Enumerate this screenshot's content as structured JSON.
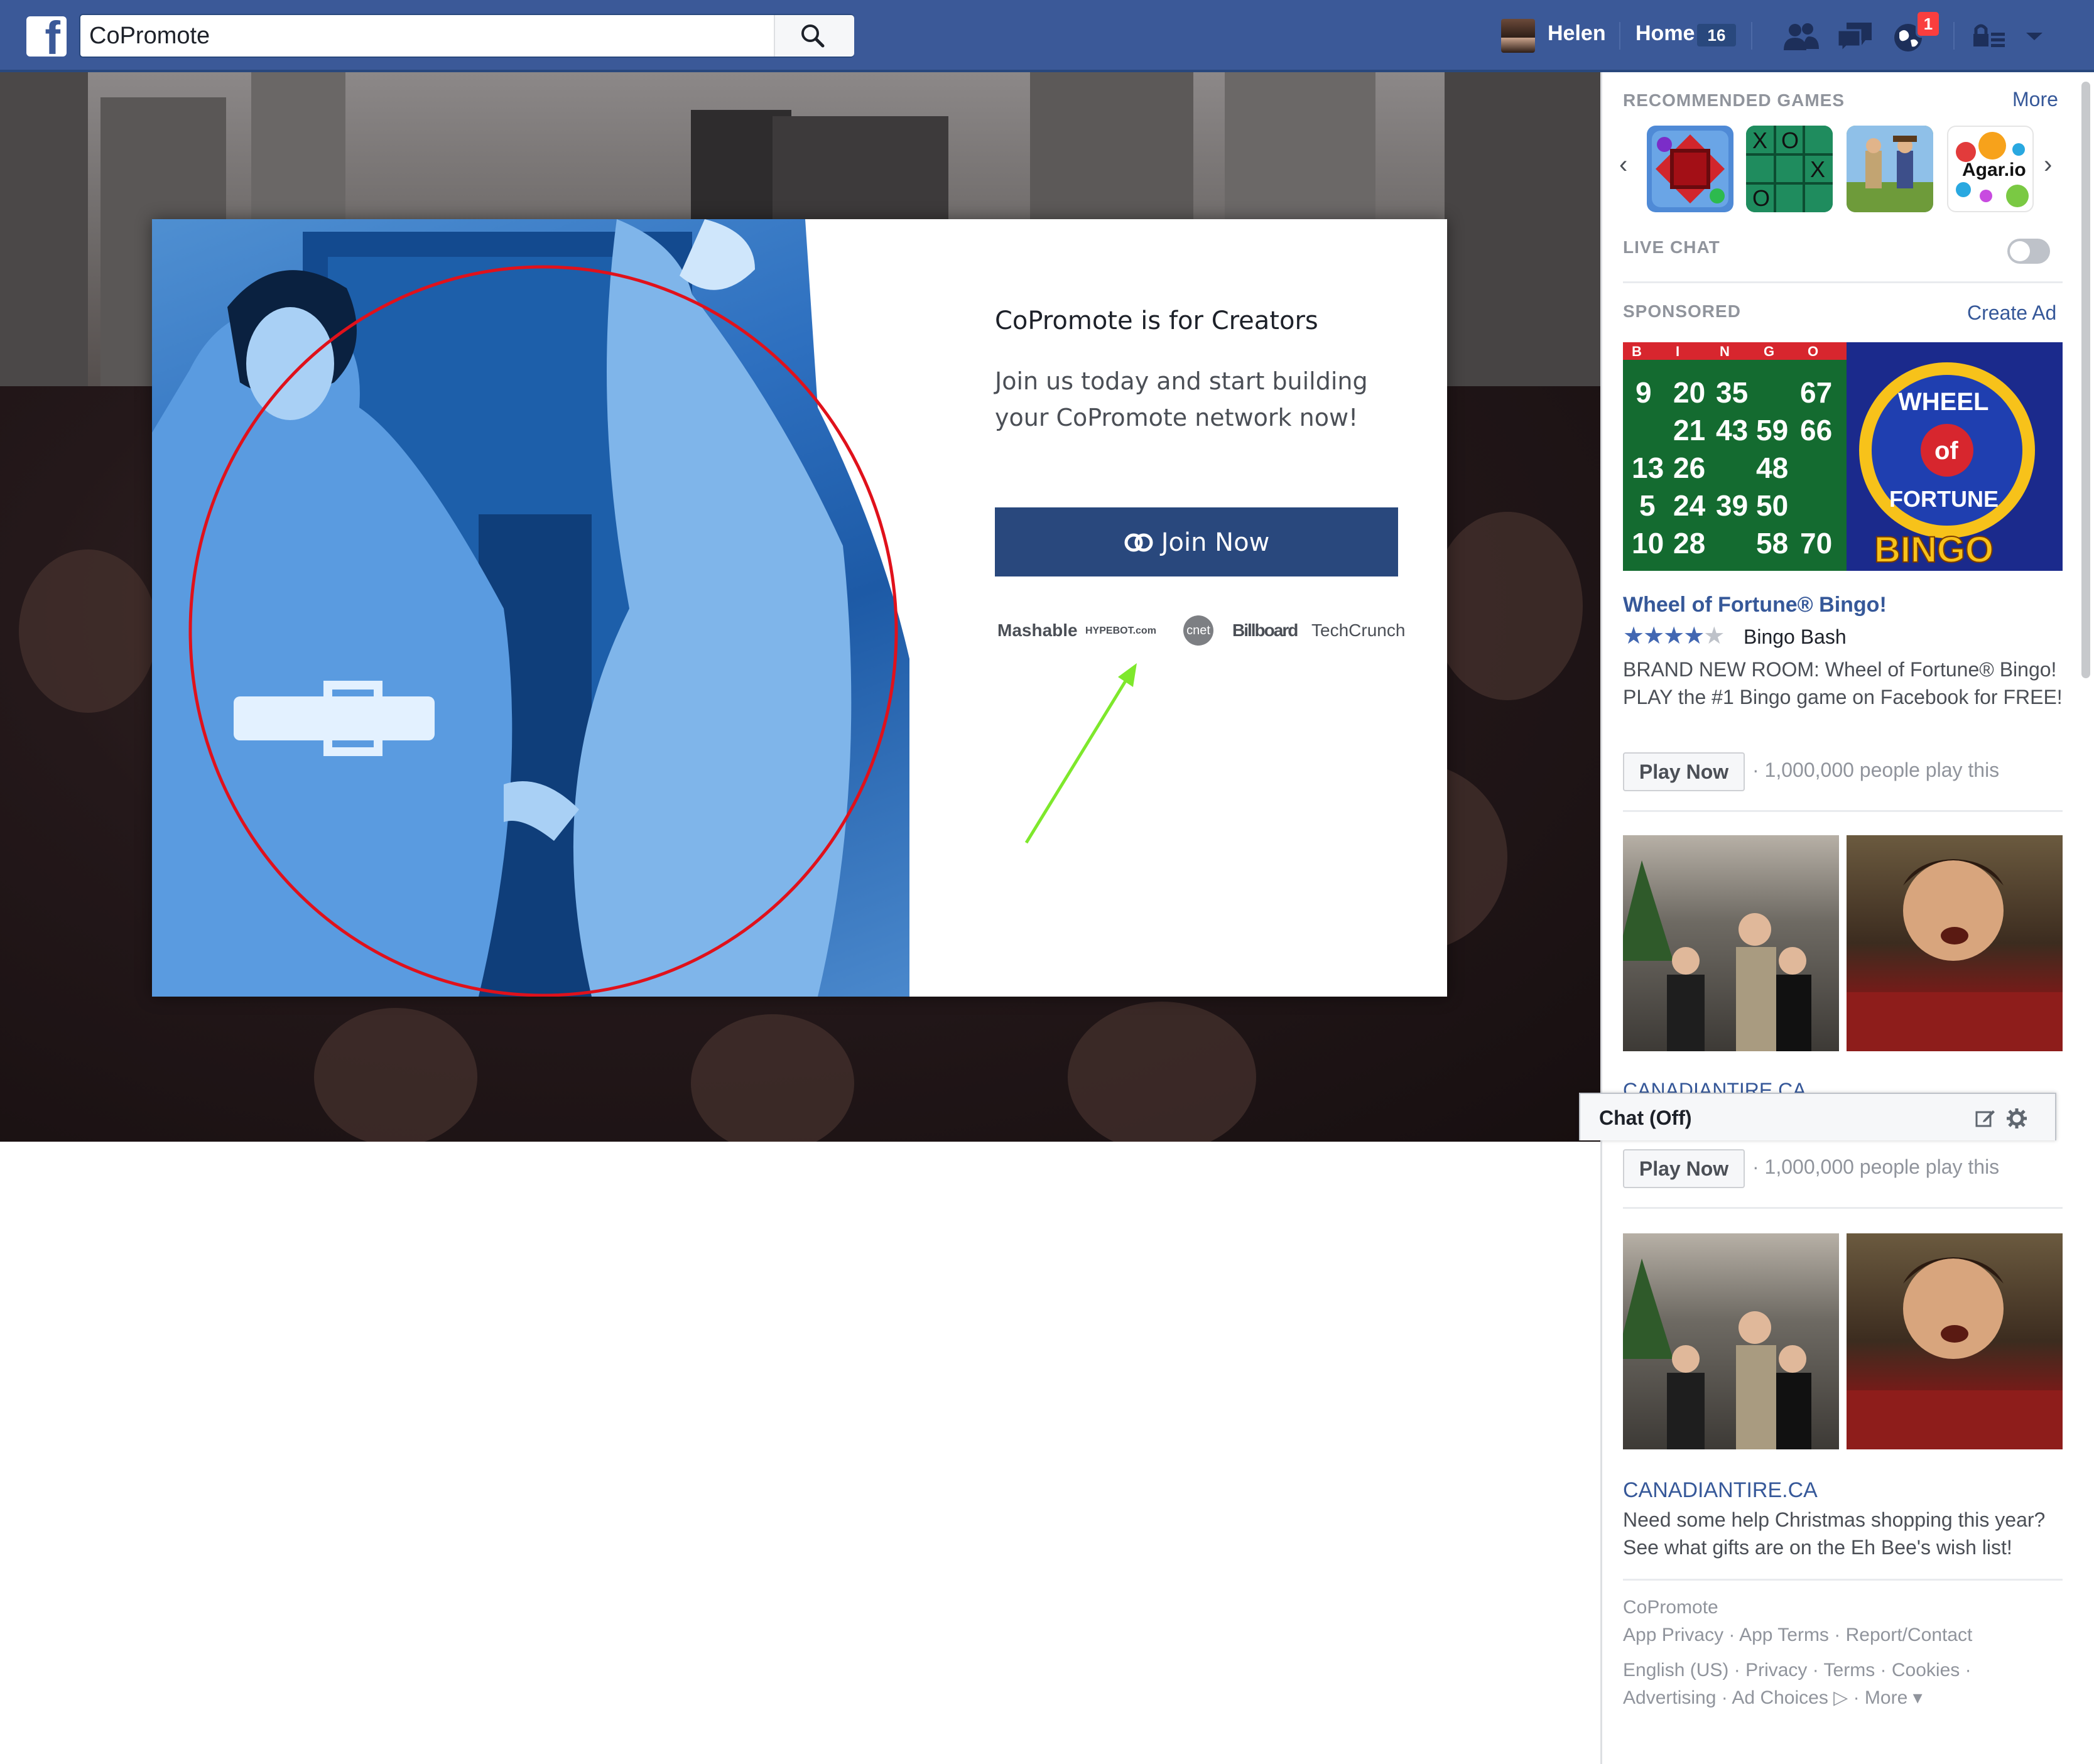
{
  "topbar": {
    "logo_letter": "f",
    "search_value": "CoPromote",
    "user_name": "Helen",
    "home_label": "Home",
    "home_count": "16",
    "notification_count": "1",
    "brand_color": "#3b5998"
  },
  "modal": {
    "heading": "CoPromote is for Creators",
    "body": "Join us today and start building your CoPromote network now!",
    "join_label": "Join Now",
    "press": {
      "mashable": "Mashable",
      "hypebot": "HYPEBOT.com",
      "cnet": "cnet",
      "billboard": "Billboard",
      "techcrunch": "TechCrunch"
    },
    "button_color": "#29487d",
    "annotation_circle_color": "#e0111b",
    "annotation_arrow_color": "#7ee82c"
  },
  "sidebar": {
    "games_title": "RECOMMENDED GAMES",
    "games_more": "More",
    "games": [
      {
        "name": "red-cube-game"
      },
      {
        "name": "tic-tac-toe-game",
        "glyphs": [
          "X",
          "O",
          "X",
          "O"
        ]
      },
      {
        "name": "cowboy-game"
      },
      {
        "name": "agar-io-game",
        "label": "Agar.io"
      }
    ],
    "live_chat_label": "LIVE CHAT",
    "sponsored_label": "SPONSORED",
    "create_ad": "Create Ad",
    "ad1": {
      "title": "Wheel of Fortune® Bingo!",
      "rating": 4,
      "stars_filled": "★★★★",
      "stars_empty": "★",
      "subtitle": "Bingo Bash",
      "description": "BRAND NEW ROOM: Wheel of Fortune® Bingo! PLAY the #1 Bingo game on Facebook for FREE!",
      "button": "Play Now",
      "note": "· 1,000,000 people play this",
      "bingo_numbers": [
        "9",
        "20",
        "35",
        "67",
        "21",
        "43",
        "59",
        "66",
        "13",
        "26",
        "48",
        "5",
        "24",
        "39",
        "50",
        "10",
        "28",
        "58",
        "70"
      ],
      "bingo_letters": [
        "B",
        "I",
        "N",
        "G",
        "O"
      ],
      "wheel_text_1": "WHEEL",
      "wheel_text_2": "of",
      "wheel_text_3": "FORTUNE",
      "bingo_word": "BINGO"
    },
    "ad2": {
      "domain_partial": "CANADIANTIRE.CA",
      "button": "Play Now",
      "note": "· 1,000,000 people play this"
    },
    "chat": {
      "label": "Chat (Off)"
    },
    "ad3": {
      "domain": "CANADIANTIRE.CA",
      "description": "Need some help Christmas shopping this year? See what gifts are on the Eh Bee's wish list!"
    },
    "footer": {
      "app_name": "CoPromote",
      "app_privacy": "App Privacy",
      "app_terms": "App Terms",
      "report": "Report/Contact",
      "language": "English (US)",
      "privacy": "Privacy",
      "terms": "Terms",
      "cookies": "Cookies",
      "advertising": "Advertising",
      "ad_choices": "Ad Choices",
      "more": "More"
    }
  }
}
